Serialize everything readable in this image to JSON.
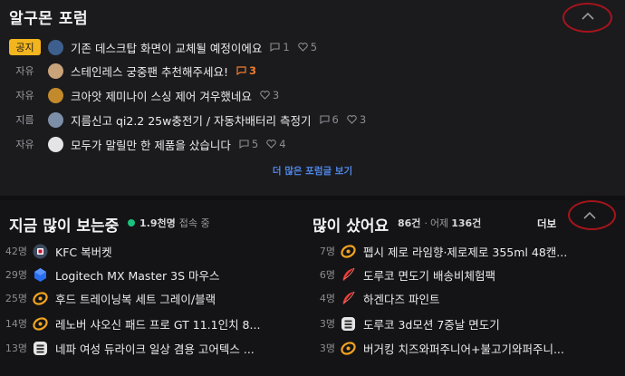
{
  "forum": {
    "title": "알구몬 포럼",
    "more_link": "더 많은 포럼글 보기",
    "posts": [
      {
        "tag": "공지",
        "title": "기존 데스크탑 화면이 교체될 예정이에요",
        "comments": "1",
        "likes": "5",
        "avatar_color": "#3d5f8e"
      },
      {
        "tag": "자유",
        "title": "스테인레스 궁중팬 추천해주세요!",
        "comments": "3",
        "likes": "",
        "avatar_color": "#c9a37a"
      },
      {
        "tag": "자유",
        "title": "크아앗 제미나이 스싱 제어 겨우했네요",
        "comments": "",
        "likes": "3",
        "avatar_color": "#c28a2b"
      },
      {
        "tag": "지름",
        "title": "지름신고 qi2.2 25w충전기 / 자동차배터리 측정기",
        "comments": "6",
        "likes": "3",
        "avatar_color": "#7d8fa8"
      },
      {
        "tag": "자유",
        "title": "모두가 말릴만 한 제품을 샀습니다",
        "comments": "5",
        "likes": "4",
        "avatar_color": "#e4e4e6"
      }
    ]
  },
  "popular": {
    "title": "지금 많이 보는중",
    "viewers": "1.9천명",
    "viewers_suffix": "접속 중",
    "items": [
      {
        "count": "42명",
        "name": "KFC 복버켓",
        "logo": "kfc-logo"
      },
      {
        "count": "29명",
        "name": "Logitech MX Master 3S 마우스",
        "logo": "logitech-logo"
      },
      {
        "count": "25명",
        "name": "후드 트레이닝복 세트 그레이/블랙",
        "logo": "shop-logo"
      },
      {
        "count": "14명",
        "name": "레노버 샤오신 패드 프로 GT 11.1인치 8...",
        "logo": "shop-logo"
      },
      {
        "count": "13명",
        "name": "네파 여성 듀라이크 일상 겸용 고어텍스 ...",
        "logo": "market-logo"
      }
    ]
  },
  "bought": {
    "title": "많이 샀어요",
    "count": "86건",
    "separator": "·",
    "yesterday_label": "어제",
    "yesterday_count": "136건",
    "more": "더보",
    "items": [
      {
        "count": "7명",
        "name": "펩시 제로 라임향·제로제로 355ml 48캔...",
        "logo": "shop-logo"
      },
      {
        "count": "6명",
        "name": "도루코 면도기 배송비체험팩",
        "logo": "feather-logo"
      },
      {
        "count": "4명",
        "name": "하겐다즈 파인트",
        "logo": "feather-logo"
      },
      {
        "count": "3명",
        "name": "도루코 3d모션 7중날 면도기",
        "logo": "market-logo"
      },
      {
        "count": "3명",
        "name": "버거킹 치즈와퍼주니어+불고기와퍼주니...",
        "logo": "shop-logo"
      }
    ]
  },
  "colors": {
    "accent_blue": "#4f86e6",
    "notice_yellow": "#f2b51e",
    "hot_orange": "#f27b2c",
    "online_green": "#19c37d",
    "annotation_red": "#a5141b"
  }
}
